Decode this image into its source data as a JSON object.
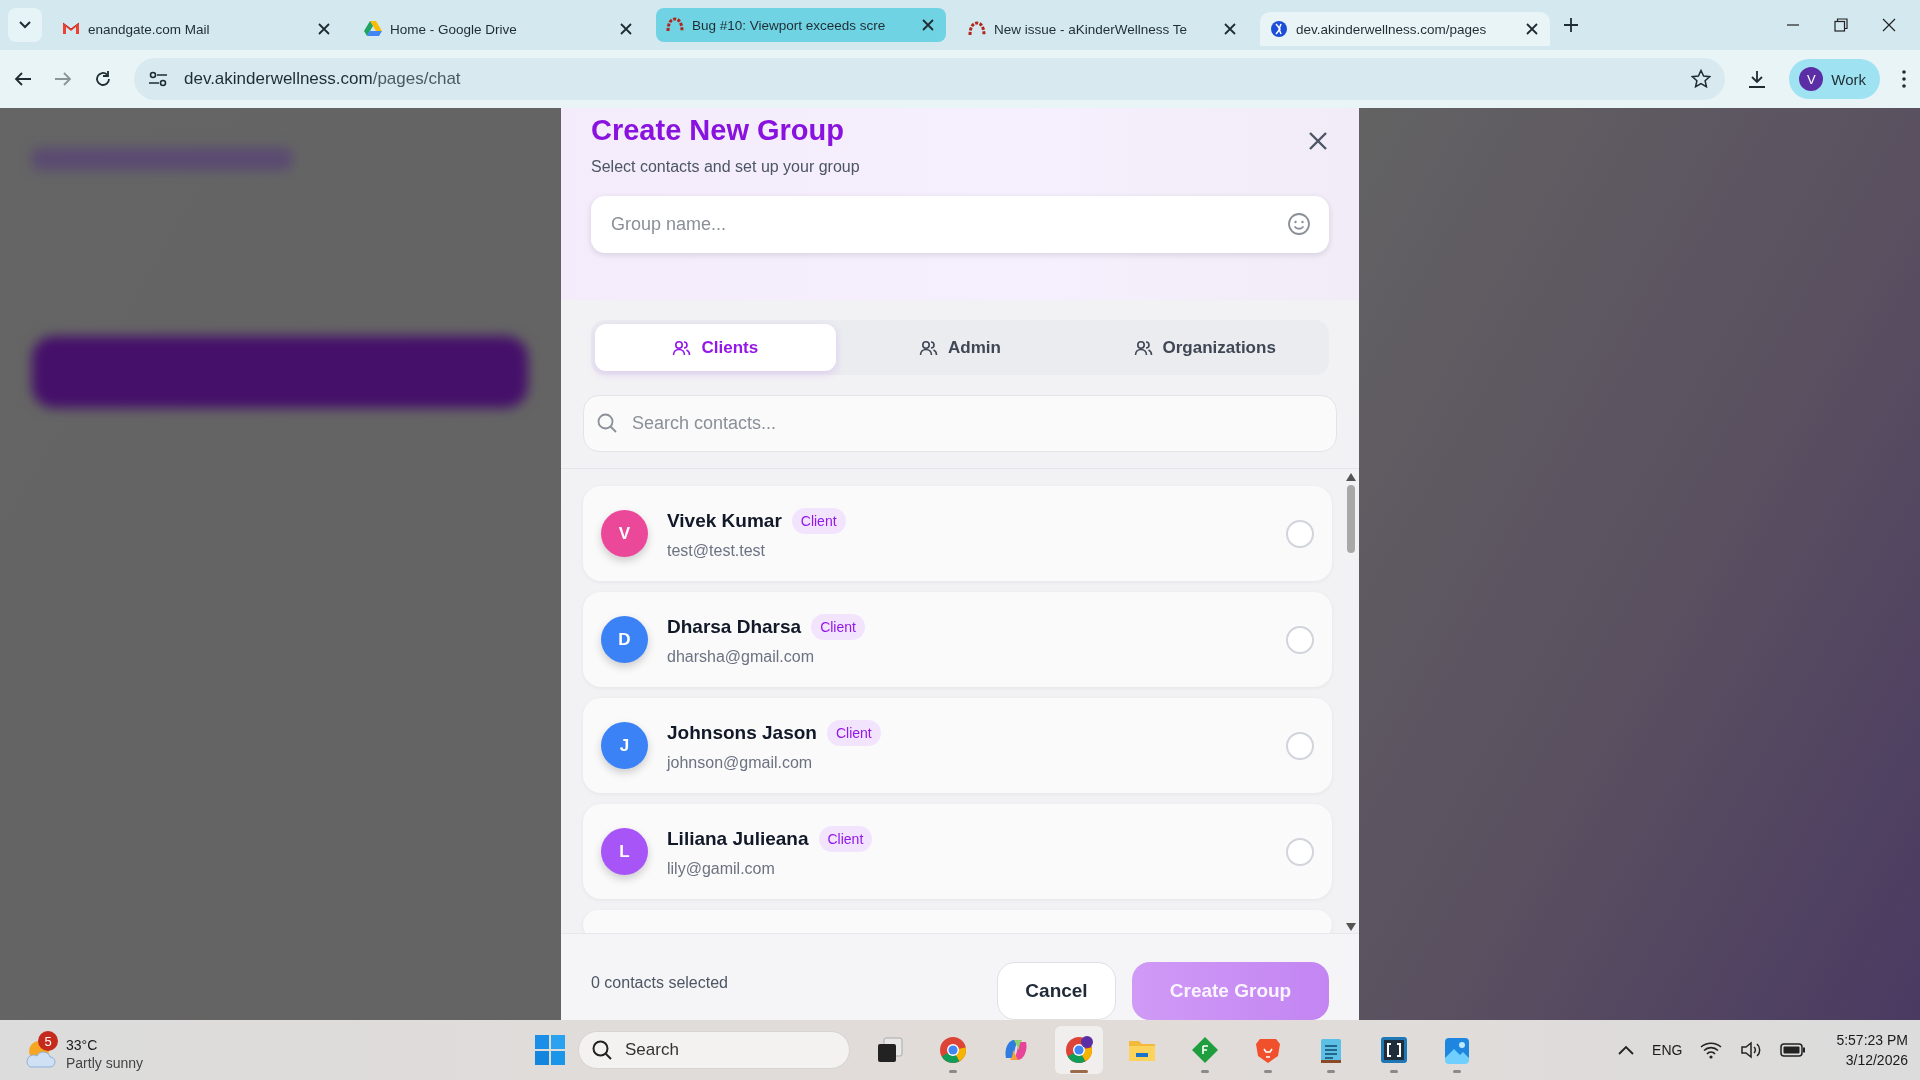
{
  "browser": {
    "tabs": [
      {
        "kind": "mail",
        "title": "enandgate.com Mail",
        "selected": false,
        "highlighted": false
      },
      {
        "kind": "drive",
        "title": "Home - Google Drive",
        "selected": false,
        "highlighted": false
      },
      {
        "kind": "arc",
        "title": "Bug #10: Viewport exceeds scre",
        "selected": false,
        "highlighted": true
      },
      {
        "kind": "arc",
        "title": "New issue - aKinderWellness Te",
        "selected": false,
        "highlighted": false
      },
      {
        "kind": "site",
        "title": "dev.akinderwellness.com/pages",
        "selected": true,
        "highlighted": false
      }
    ],
    "address": {
      "host": "dev.akinderwellness.com",
      "path": "/pages/chat"
    },
    "profile": {
      "initial": "V",
      "label": "Work"
    }
  },
  "dialog": {
    "title": "Create New Group",
    "subtitle": "Select contacts and set up your group",
    "group_name": {
      "placeholder": "Group name..."
    },
    "filter_tabs": [
      {
        "label": "Clients",
        "selected": true
      },
      {
        "label": "Admin",
        "selected": false
      },
      {
        "label": "Organizations",
        "selected": false
      }
    ],
    "search": {
      "placeholder": "Search contacts..."
    },
    "contacts": [
      {
        "initial": "V",
        "name": "Vivek Kumar",
        "role": "Client",
        "email": "test@test.test",
        "color": "#ec4899",
        "checked": false
      },
      {
        "initial": "D",
        "name": "Dharsa Dharsa",
        "role": "Client",
        "email": "dharsha@gmail.com",
        "color": "#3b82f6",
        "checked": false
      },
      {
        "initial": "J",
        "name": "Johnsons Jason",
        "role": "Client",
        "email": "johnson@gmail.com",
        "color": "#3b82f6",
        "checked": false
      },
      {
        "initial": "L",
        "name": "Liliana Julieana",
        "role": "Client",
        "email": "lily@gamil.com",
        "color": "#a855f7",
        "checked": false
      }
    ],
    "selected_count": "0 contacts selected",
    "buttons": [
      {
        "kind": "cancel",
        "label": "Cancel"
      },
      {
        "kind": "create",
        "label": "Create Group",
        "disabled": true
      }
    ]
  },
  "taskbar": {
    "weather": {
      "badge": "5",
      "temperature": "33°C",
      "condition": "Partly sunny"
    },
    "search": {
      "placeholder": "Search"
    },
    "apps": [
      {
        "kind": "task-view",
        "running": false,
        "active": false
      },
      {
        "kind": "chrome",
        "running": true,
        "active": false
      },
      {
        "kind": "copilot",
        "running": false,
        "active": false
      },
      {
        "kind": "chrome-profile",
        "running": true,
        "active": true
      },
      {
        "kind": "folder",
        "running": false,
        "active": false
      },
      {
        "kind": "diamond",
        "running": true,
        "active": false
      },
      {
        "kind": "lion",
        "running": true,
        "active": false
      },
      {
        "kind": "notepad",
        "running": true,
        "active": false
      },
      {
        "kind": "brackets",
        "running": true,
        "active": false
      },
      {
        "kind": "photos",
        "running": true,
        "active": false
      }
    ],
    "language": "ENG",
    "time": "5:57:23 PM",
    "date": "3/12/2026"
  }
}
